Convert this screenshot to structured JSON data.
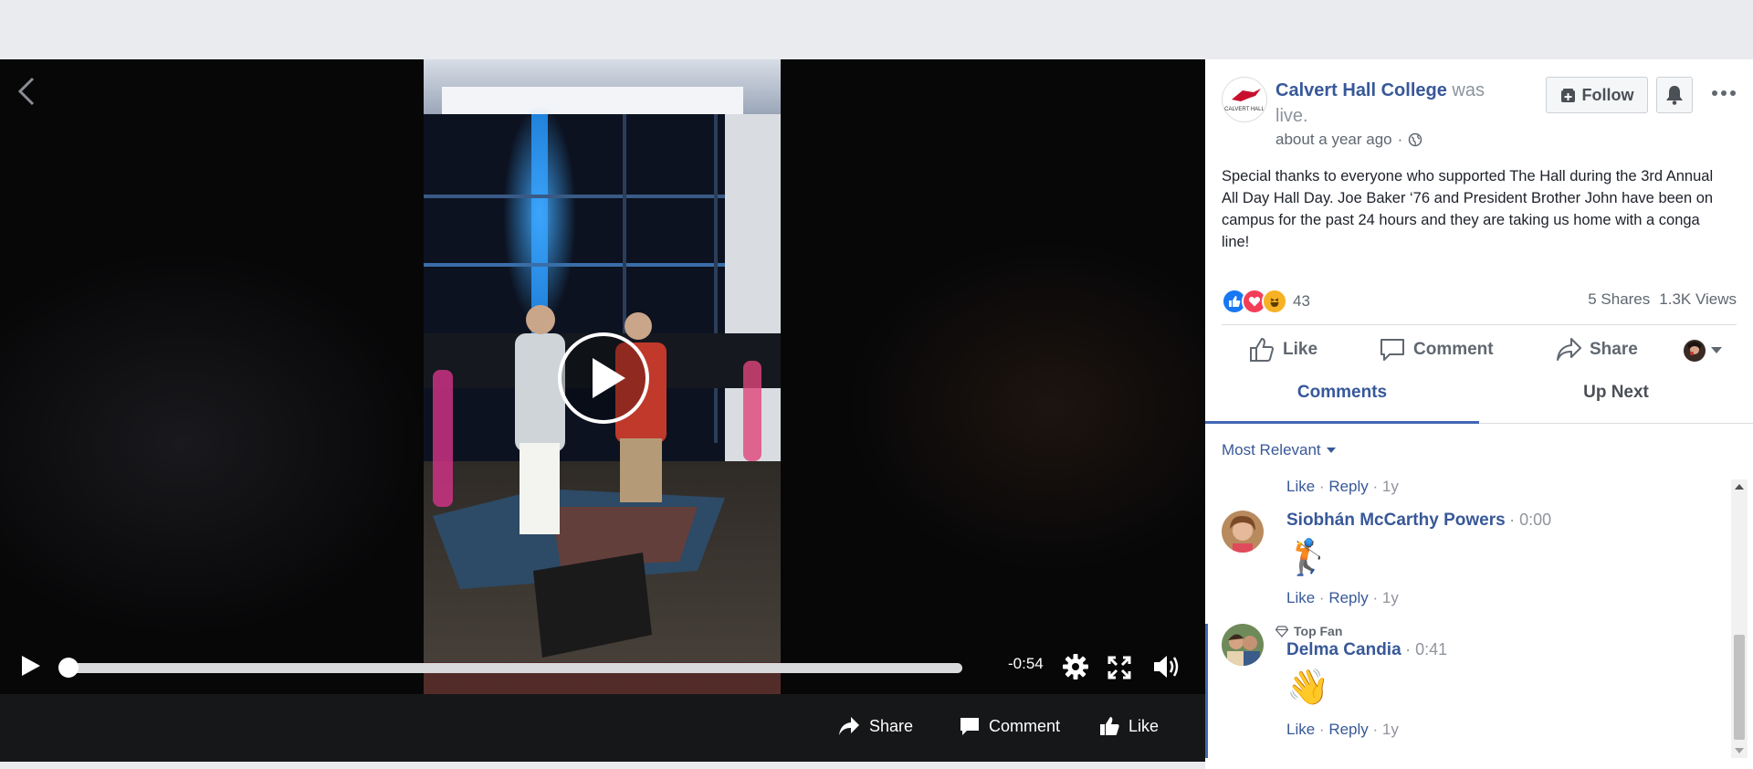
{
  "video": {
    "time_remaining": "-0:54",
    "progress": 0.0,
    "footer": {
      "share_label": "Share",
      "comment_label": "Comment",
      "like_label": "Like"
    }
  },
  "post": {
    "page_name": "Calvert Hall College",
    "page_suffix": "was live.",
    "timestamp": "about a year ago",
    "logo_text": "CALVERT HALL",
    "follow_label": "Follow",
    "text": "Special thanks to everyone who supported The Hall during the 3rd Annual All Day Hall Day. Joe Baker ‘76 and President Brother John have been on campus for the past 24 hours and they are taking us home with a conga line!",
    "reaction_count": "43",
    "shares": "5 Shares",
    "views": "1.3K Views",
    "actions": {
      "like": "Like",
      "comment": "Comment",
      "share": "Share"
    }
  },
  "tabs": {
    "comments": "Comments",
    "up_next": "Up Next"
  },
  "sort_label": "Most Relevant",
  "comments": [
    {
      "like": "Like",
      "reply": "Reply",
      "age": "1y"
    },
    {
      "name": "Siobhán McCarthy Powers",
      "time": "0:00",
      "emoji": "🏌",
      "like": "Like",
      "reply": "Reply",
      "age": "1y"
    },
    {
      "badge": "Top Fan",
      "name": "Delma Candia",
      "time": "0:41",
      "emoji": "👋",
      "like": "Like",
      "reply": "Reply",
      "age": "1y"
    }
  ],
  "colors": {
    "link_blue": "#385898",
    "tab_active": "#4267b2",
    "like_reaction": "#1877f2",
    "love_reaction": "#f33e58",
    "haha_reaction": "#f7b125"
  }
}
